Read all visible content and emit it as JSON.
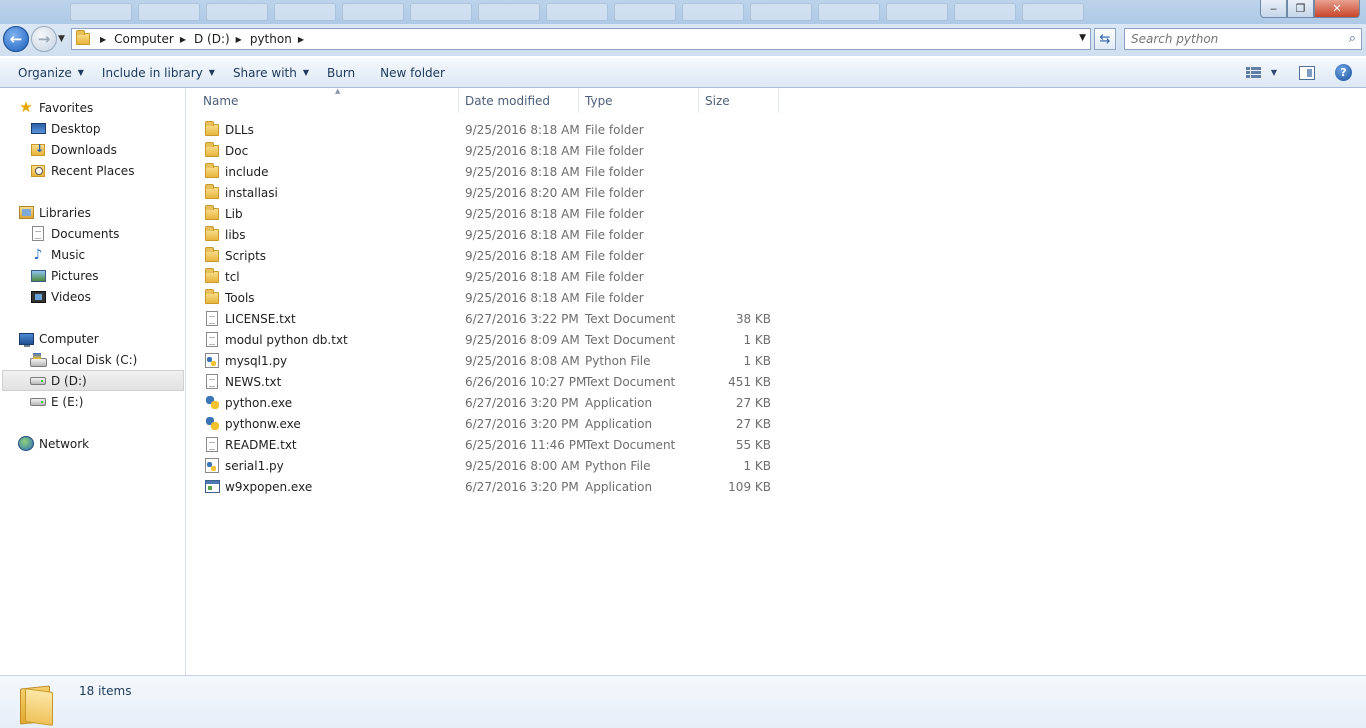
{
  "window": {
    "minimize_glyph": "‒",
    "maximize_glyph": "❐",
    "close_glyph": "✕"
  },
  "address": {
    "crumbs": [
      "Computer",
      "D (D:)",
      "python"
    ]
  },
  "search": {
    "placeholder": "Search python"
  },
  "toolbar": {
    "organize": "Organize",
    "include_in_library": "Include in library",
    "share_with": "Share with",
    "burn": "Burn",
    "new_folder": "New folder"
  },
  "nav": {
    "favorites": "Favorites",
    "desktop": "Desktop",
    "downloads": "Downloads",
    "recent_places": "Recent Places",
    "libraries": "Libraries",
    "documents": "Documents",
    "music": "Music",
    "pictures": "Pictures",
    "videos": "Videos",
    "computer": "Computer",
    "local_disk": "Local Disk (C:)",
    "d_drive": "D (D:)",
    "e_drive": "E (E:)",
    "network": "Network"
  },
  "columns": {
    "name": "Name",
    "date_modified": "Date modified",
    "type": "Type",
    "size": "Size"
  },
  "files": [
    {
      "name": "DLLs",
      "date": "9/25/2016 8:18 AM",
      "type": "File folder",
      "size": "",
      "icon": "folder-icon"
    },
    {
      "name": "Doc",
      "date": "9/25/2016 8:18 AM",
      "type": "File folder",
      "size": "",
      "icon": "folder-icon"
    },
    {
      "name": "include",
      "date": "9/25/2016 8:18 AM",
      "type": "File folder",
      "size": "",
      "icon": "folder-icon"
    },
    {
      "name": "installasi",
      "date": "9/25/2016 8:20 AM",
      "type": "File folder",
      "size": "",
      "icon": "folder-icon"
    },
    {
      "name": "Lib",
      "date": "9/25/2016 8:18 AM",
      "type": "File folder",
      "size": "",
      "icon": "folder-icon"
    },
    {
      "name": "libs",
      "date": "9/25/2016 8:18 AM",
      "type": "File folder",
      "size": "",
      "icon": "folder-icon"
    },
    {
      "name": "Scripts",
      "date": "9/25/2016 8:18 AM",
      "type": "File folder",
      "size": "",
      "icon": "folder-icon"
    },
    {
      "name": "tcl",
      "date": "9/25/2016 8:18 AM",
      "type": "File folder",
      "size": "",
      "icon": "folder-icon"
    },
    {
      "name": "Tools",
      "date": "9/25/2016 8:18 AM",
      "type": "File folder",
      "size": "",
      "icon": "folder-icon"
    },
    {
      "name": "LICENSE.txt",
      "date": "6/27/2016 3:22 PM",
      "type": "Text Document",
      "size": "38 KB",
      "icon": "text-document-icon"
    },
    {
      "name": "modul python db.txt",
      "date": "9/25/2016 8:09 AM",
      "type": "Text Document",
      "size": "1 KB",
      "icon": "text-document-icon"
    },
    {
      "name": "mysql1.py",
      "date": "9/25/2016 8:08 AM",
      "type": "Python File",
      "size": "1 KB",
      "icon": "python-file-icon"
    },
    {
      "name": "NEWS.txt",
      "date": "6/26/2016 10:27 PM",
      "type": "Text Document",
      "size": "451 KB",
      "icon": "text-document-icon"
    },
    {
      "name": "python.exe",
      "date": "6/27/2016 3:20 PM",
      "type": "Application",
      "size": "27 KB",
      "icon": "python-exe-icon"
    },
    {
      "name": "pythonw.exe",
      "date": "6/27/2016 3:20 PM",
      "type": "Application",
      "size": "27 KB",
      "icon": "python-exe-icon"
    },
    {
      "name": "README.txt",
      "date": "6/25/2016 11:46 PM",
      "type": "Text Document",
      "size": "55 KB",
      "icon": "text-document-icon"
    },
    {
      "name": "serial1.py",
      "date": "9/25/2016 8:00 AM",
      "type": "Python File",
      "size": "1 KB",
      "icon": "python-file-icon"
    },
    {
      "name": "w9xpopen.exe",
      "date": "6/27/2016 3:20 PM",
      "type": "Application",
      "size": "109 KB",
      "icon": "application-icon"
    }
  ],
  "status": {
    "item_count": "18 items"
  }
}
